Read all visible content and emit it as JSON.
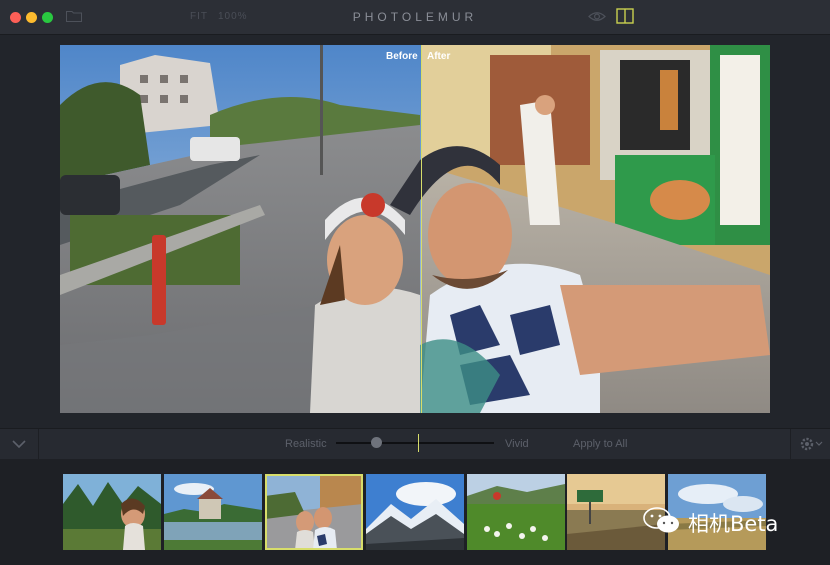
{
  "toolbar": {
    "fit_label": "FIT",
    "zoom_label": "100%",
    "title": "PHOTOLEMUR",
    "icons": [
      "folder-icon",
      "eye-icon",
      "split-view-icon"
    ]
  },
  "preview": {
    "before_label": "Before",
    "after_label": "After"
  },
  "controls": {
    "realistic_label": "Realistic",
    "vivid_label": "Vivid",
    "apply_all_label": "Apply to All",
    "enhancement_level": 0.25,
    "icons": [
      "chevron-down-icon",
      "gear-icon"
    ]
  },
  "filmstrip": {
    "thumbnails": [
      "thumbnail-1",
      "thumbnail-2",
      "thumbnail-3",
      "thumbnail-4",
      "thumbnail-5",
      "thumbnail-6",
      "thumbnail-7"
    ],
    "selected_index": 2
  },
  "watermark": {
    "text": "相机Beta"
  },
  "colors": {
    "accent": "#d7dd6a",
    "titlebar": "#2c2f36",
    "background": "#22252b"
  }
}
